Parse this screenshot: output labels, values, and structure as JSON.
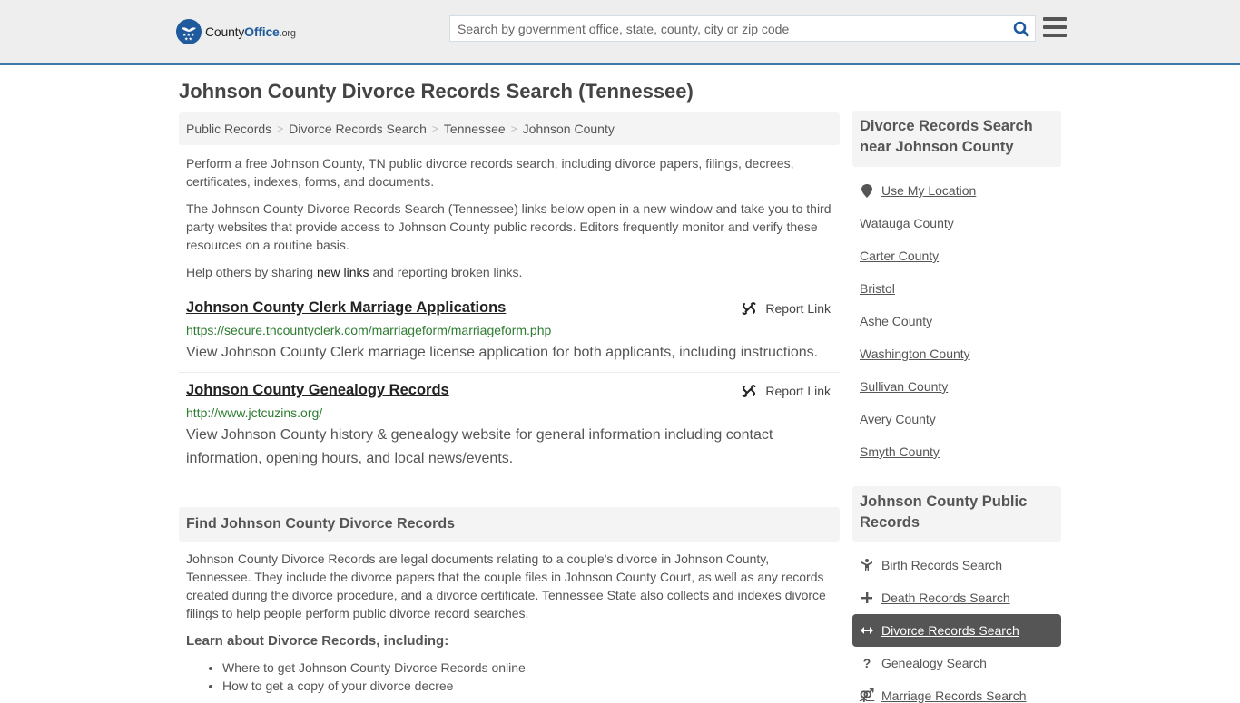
{
  "header": {
    "logo": {
      "name_part1": "County",
      "name_part2": "Office",
      "name_part3": ".org"
    },
    "search": {
      "placeholder": "Search by government office, state, county, city or zip code",
      "value": ""
    },
    "colors": {
      "brand": "#1e5a9c",
      "header_border": "#3d78a8"
    }
  },
  "page": {
    "title": "Johnson County Divorce Records Search (Tennessee)",
    "breadcrumb": [
      "Public Records",
      "Divorce Records Search",
      "Tennessee",
      "Johnson County"
    ],
    "intro": {
      "p1": "Perform a free Johnson County, TN public divorce records search, including divorce papers, filings, decrees, certificates, indexes, forms, and documents.",
      "p2": "The Johnson County Divorce Records Search (Tennessee) links below open in a new window and take you to third party websites that provide access to Johnson County public records. Editors frequently monitor and verify these resources on a routine basis.",
      "p3_before": "Help others by sharing ",
      "p3_link": "new links",
      "p3_after": " and reporting broken links."
    },
    "results": [
      {
        "title": "Johnson County Clerk Marriage Applications",
        "url": "https://secure.tncountyclerk.com/marriageform/marriageform.php",
        "description": "View Johnson County Clerk marriage license application for both applicants, including instructions.",
        "report_label": "Report Link"
      },
      {
        "title": "Johnson County Genealogy Records",
        "url": "http://www.jctcuzins.org/",
        "description": "View Johnson County history & genealogy website for general information including contact information, opening hours, and local news/events.",
        "report_label": "Report Link"
      }
    ],
    "find_section": {
      "heading": "Find Johnson County Divorce Records",
      "body": "Johnson County Divorce Records are legal documents relating to a couple's divorce in Johnson County, Tennessee. They include the divorce papers that the couple files in Johnson County Court, as well as any records created during the divorce procedure, and a divorce certificate. Tennessee State also collects and indexes divorce filings to help people perform public divorce record searches.",
      "learn_heading": "Learn about Divorce Records, including:",
      "learn_items": [
        "Where to get Johnson County Divorce Records online",
        "How to get a copy of your divorce decree"
      ]
    }
  },
  "sidebar": {
    "nearby": {
      "heading": "Divorce Records Search near Johnson County",
      "use_location": "Use My Location",
      "items": [
        "Watauga County",
        "Carter County",
        "Bristol",
        "Ashe County",
        "Washington County",
        "Sullivan County",
        "Avery County",
        "Smyth County"
      ]
    },
    "public_records": {
      "heading": "Johnson County Public Records",
      "items": [
        {
          "label": "Birth Records Search",
          "icon": "child-icon",
          "glyph": "Ὣ8",
          "active": false
        },
        {
          "label": "Death Records Search",
          "icon": "plus-icon",
          "glyph": "+",
          "active": false
        },
        {
          "label": "Divorce Records Search",
          "icon": "arrows-horizontal-icon",
          "glyph": "↔",
          "active": true
        },
        {
          "label": "Genealogy Search",
          "icon": "question-icon",
          "glyph": "?",
          "active": false
        },
        {
          "label": "Marriage Records Search",
          "icon": "marriage-symbol-icon",
          "glyph": "⚤",
          "active": false
        }
      ]
    }
  }
}
